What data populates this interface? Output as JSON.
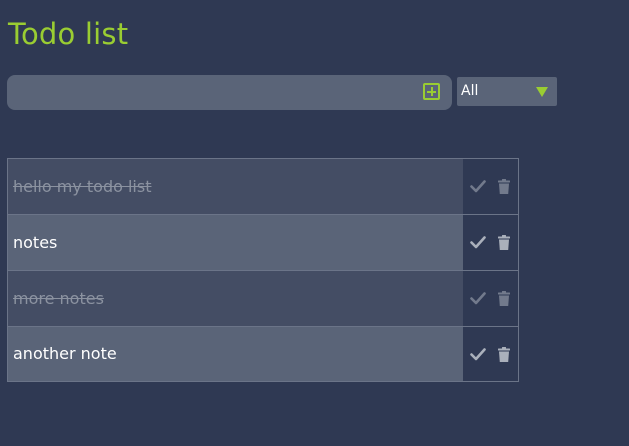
{
  "app": {
    "title": "Todo list"
  },
  "input": {
    "value": "",
    "placeholder": ""
  },
  "filter": {
    "selected": "All"
  },
  "colors": {
    "accent": "#9acd32",
    "background": "#2f3953",
    "item_open": "#5a6478",
    "item_done": "#444d64"
  },
  "todos": [
    {
      "text": "hello my todo list",
      "done": true
    },
    {
      "text": "notes",
      "done": false
    },
    {
      "text": "more notes",
      "done": true
    },
    {
      "text": "another note",
      "done": false
    }
  ],
  "icons": {
    "add": "plus-square-icon",
    "filter": "triangle-down-icon",
    "complete": "checkmark-icon",
    "delete": "trash-icon"
  }
}
